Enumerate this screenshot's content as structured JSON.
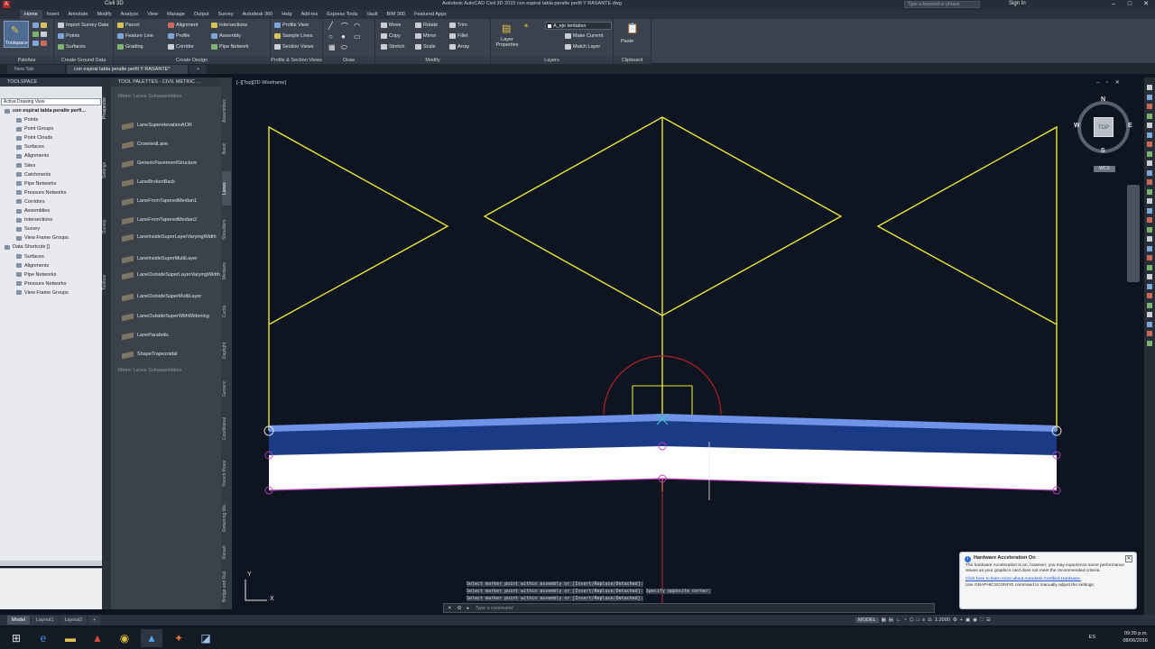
{
  "titlebar": {
    "workspace": "Civil 3D",
    "title": "Autodesk AutoCAD Civil 3D 2015    con espiral tabla peralte perfil Y RASANTE.dwg",
    "search_placeholder": "Type a keyword or phrase",
    "sign_in": "Sign In",
    "minimize": "–",
    "maximize": "□",
    "close": "✕"
  },
  "menu": [
    "Home",
    "Insert",
    "Annotate",
    "Modify",
    "Analyze",
    "View",
    "Manage",
    "Output",
    "Survey",
    "Autodesk 360",
    "Help",
    "Add-ins",
    "Express Tools",
    "Vault",
    "BIM 360",
    "Featured Apps"
  ],
  "ribbon": {
    "toolspace": "Toolspace",
    "palettes_label": "Palettes",
    "import_survey": "Import Survey Data",
    "points": "Points",
    "surfaces": "Surfaces",
    "create_ground_label": "Create Ground Data",
    "parcel": "Parcel",
    "feature_line": "Feature Line",
    "grading": "Grading",
    "alignment": "Alignment",
    "profile": "Profile",
    "corridor": "Corridor",
    "intersections": "Intersections",
    "assembly": "Assembly",
    "pipe_network": "Pipe Network",
    "create_design_label": "Create Design",
    "profile_view": "Profile View",
    "sample_lines": "Sample Lines",
    "section_views": "Section Views",
    "profile_section_label": "Profile & Section Views",
    "draw_label": "Draw",
    "move": "Move",
    "rotate": "Rotate",
    "trim": "Trim",
    "copy": "Copy",
    "mirror": "Mirror",
    "fillet": "Fillet",
    "stretch": "Stretch",
    "scale": "Scale",
    "array": "Array",
    "modify_label": "Modify",
    "layer_properties": "Layer Properties",
    "current_layer": "A_eje tentativo",
    "make_current": "Make Current",
    "match_layer": "Match Layer",
    "layers_label": "Layers",
    "paste": "Paste",
    "clipboard_label": "Clipboard"
  },
  "doc_tabs": {
    "new_tab": "New Tab",
    "active_tab": "con espiral tabla peralte perfil Y RASANTE*",
    "add": "+"
  },
  "toolspace": {
    "title": "TOOLSPACE",
    "view_selector": "Active Drawing View",
    "root": "con espiral tabla peralte perfi...",
    "items": [
      "Points",
      "Point Groups",
      "Point Clouds",
      "Surfaces",
      "Alignments",
      "Sites",
      "Catchments",
      "Pipe Networks",
      "Pressure Networks",
      "Corridors",
      "Assemblies",
      "Intersections",
      "Survey",
      "View Frame Groups"
    ],
    "shortcuts_root": "Data Shortcuts []",
    "shortcut_items": [
      "Surfaces",
      "Alignments",
      "Pipe Networks",
      "Pressure Networks",
      "View Frame Groups"
    ],
    "side_tabs": [
      "Prospector",
      "Settings",
      "Survey",
      "Toolbox"
    ]
  },
  "palette": {
    "title": "TOOL PALETTES - CIVIL METRIC ...",
    "section_top": "Metric Lanes Subassemblies",
    "section_bottom": "Metric Lanes Subassemblies",
    "items": [
      "LaneSuperelevationAOR",
      "CrownedLane",
      "GenericPavementStructure",
      "LaneBrokenBack",
      "LaneFromTaperedMedian1",
      "LaneFromTaperedMedian2",
      "LaneInsideSuperLayerVaryingWidth",
      "LaneInsideSuperMultiLayer",
      "LaneOutsideSuperLayerVaryingWidth",
      "LaneOutsideSuperMultiLayer",
      "LaneOutsideSuperWithWidening",
      "LaneParabolic",
      "ShapeTrapezoidal"
    ],
    "tabs": [
      "Assemblies",
      "Basic",
      "Lanes",
      "Shoulders",
      "Medians",
      "Curbs",
      "Daylight",
      "Generic",
      "Conditional",
      "Trench Pipes",
      "Retaining Wa...",
      "Rehab",
      "Bridge and Rail"
    ]
  },
  "viewport": {
    "label": "[–][Top][2D Wireframe]",
    "controls": "– ▫ ✕",
    "compass": {
      "n": "N",
      "s": "S",
      "e": "E",
      "w": "W",
      "top": "TOP",
      "wcs": "WCS"
    },
    "ucs": {
      "x": "X",
      "y": "Y"
    }
  },
  "command": {
    "history": [
      "Select marker point within assembly or [Insert/Replace/Detached]:",
      "Select marker point within assembly or [Insert/Replace/Detached]:",
      "Select marker point within assembly or [Insert/Replace/Detached]:"
    ],
    "history_suffix": "Specify opposite corner:",
    "placeholder": "Type a command"
  },
  "notification": {
    "title": "Hardware Acceleration On",
    "body": "The hardware Acceleration is on, however, you may experience some performance issues as your graphics card does not meet the recommended criteria.",
    "link": "Click here to learn more about  Autodesk Certified Hardware.",
    "footer": "Use GRAPHICSCONFIG command to manually adjust the settings.",
    "close": "✕",
    "info": "i"
  },
  "layout_tabs": [
    "Model",
    "Layout1",
    "Layout2"
  ],
  "layout_add": "+",
  "status": {
    "model": "MODEL",
    "scale": "1:2000"
  },
  "taskbar": {
    "lang": "ES",
    "time": "09:35 p.m.",
    "date": "08/06/2016"
  },
  "colors": {
    "yellow": "#e8e83a",
    "blue_band": "#1b3a86",
    "blue_edge": "#6f93e8",
    "red": "#c2292b",
    "magenta": "#c040c0",
    "background": "#0e1420"
  }
}
